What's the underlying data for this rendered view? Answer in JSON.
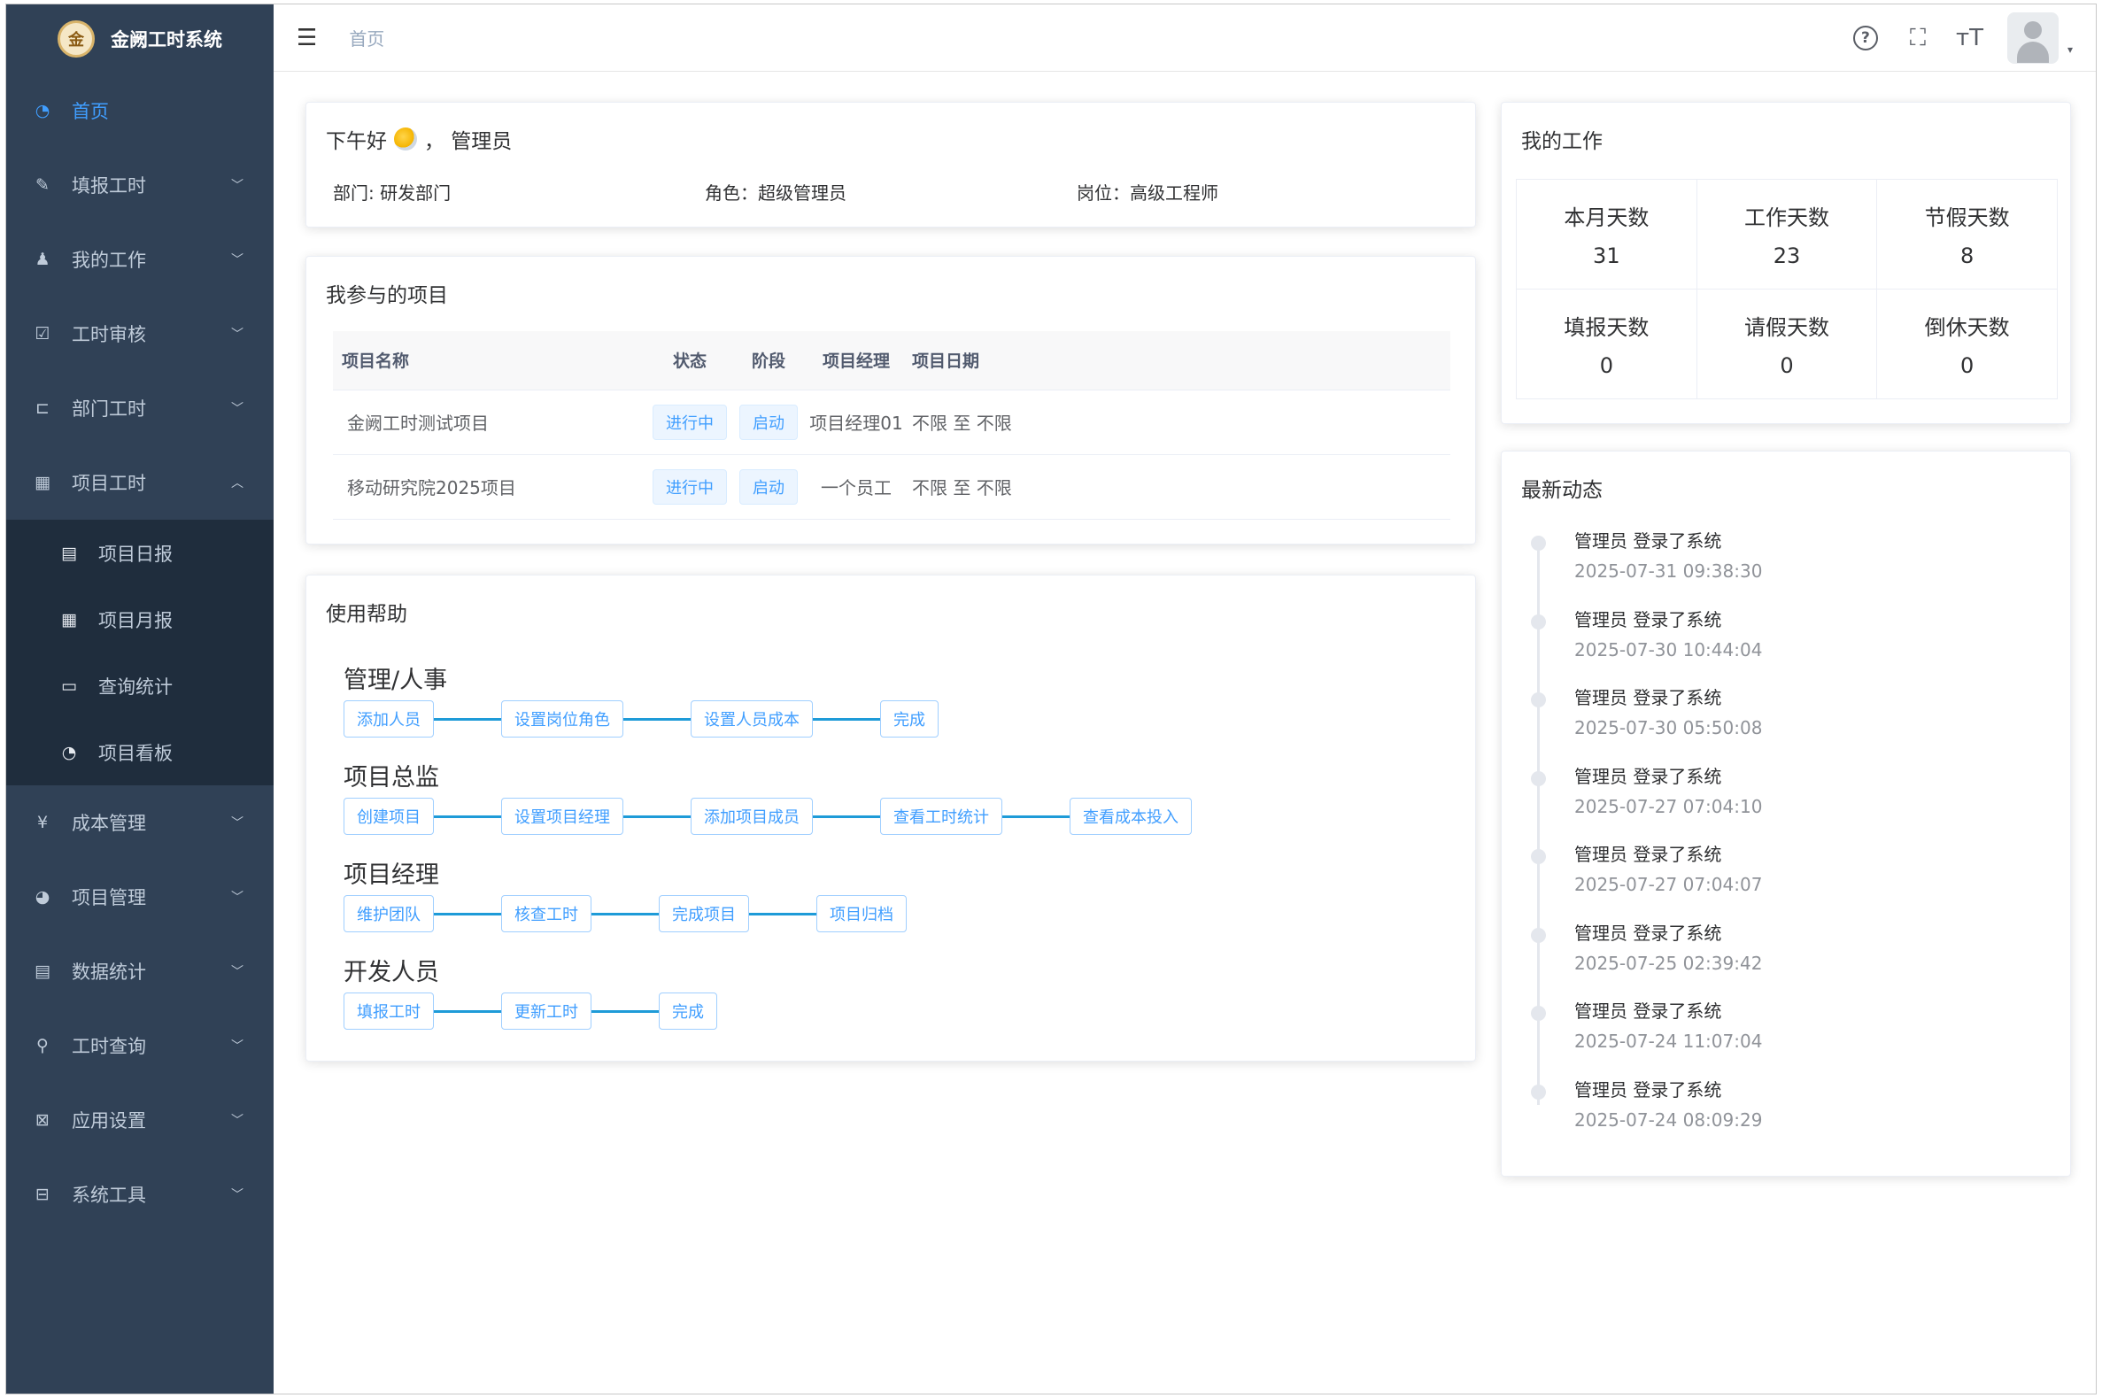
{
  "app": {
    "title": "金阙工时系统",
    "logo_glyph": "金"
  },
  "sidebar": {
    "items": [
      {
        "label": "首页",
        "icon": "dashboard-icon",
        "glyph": "◔",
        "active": true
      },
      {
        "label": "填报工时",
        "icon": "edit-icon",
        "glyph": "✎"
      },
      {
        "label": "我的工作",
        "icon": "user-icon",
        "glyph": "♟"
      },
      {
        "label": "工时审核",
        "icon": "checkbox-icon",
        "glyph": "☑"
      },
      {
        "label": "部门工时",
        "icon": "tree-icon",
        "glyph": "⊏"
      },
      {
        "label": "项目工时",
        "icon": "table-icon",
        "glyph": "▦",
        "expanded": true
      },
      {
        "label": "成本管理",
        "icon": "yen-icon",
        "glyph": "¥"
      },
      {
        "label": "项目管理",
        "icon": "globe-icon",
        "glyph": "◕"
      },
      {
        "label": "数据统计",
        "icon": "chart-icon",
        "glyph": "▤"
      },
      {
        "label": "工时查询",
        "icon": "search-icon",
        "glyph": "⚲"
      },
      {
        "label": "应用设置",
        "icon": "settings-icon",
        "glyph": "⊠"
      },
      {
        "label": "系统工具",
        "icon": "toolbox-icon",
        "glyph": "⊟"
      }
    ],
    "subitems": [
      {
        "label": "项目日报",
        "icon": "document-icon",
        "glyph": "▤"
      },
      {
        "label": "项目月报",
        "icon": "grid-icon",
        "glyph": "▦"
      },
      {
        "label": "查询统计",
        "icon": "stats-icon",
        "glyph": "▭"
      },
      {
        "label": "项目看板",
        "icon": "gauge-icon",
        "glyph": "◔"
      }
    ],
    "chevron_down": "﹀",
    "chevron_up": "︿"
  },
  "header": {
    "breadcrumb": "首页",
    "hamburger_glyph": "☰",
    "help_glyph": "?",
    "fullscreen_glyph": "⛶",
    "fontsize_glyph": "ᴛT",
    "caret_glyph": "▾"
  },
  "greeting": {
    "text_before": "下午好",
    "text_after": "， 管理员",
    "dept": "部门: 研发部门",
    "role": "角色：超级管理员",
    "post": "岗位：高级工程师"
  },
  "projects": {
    "title": "我参与的项目",
    "headers": [
      "项目名称",
      "状态",
      "阶段",
      "项目经理",
      "项目日期"
    ],
    "rows": [
      {
        "name": "金阙工时测试项目",
        "status": "进行中",
        "stage": "启动",
        "manager": "项目经理01",
        "date": "不限 至 不限"
      },
      {
        "name": "移动研究院2025项目",
        "status": "进行中",
        "stage": "启动",
        "manager": "一个员工",
        "date": "不限 至 不限"
      }
    ]
  },
  "help": {
    "title": "使用帮助",
    "flows": [
      {
        "title": "管理/人事",
        "steps": [
          "添加人员",
          "设置岗位角色",
          "设置人员成本",
          "完成"
        ]
      },
      {
        "title": "项目总监",
        "steps": [
          "创建项目",
          "设置项目经理",
          "添加项目成员",
          "查看工时统计",
          "查看成本投入"
        ]
      },
      {
        "title": "项目经理",
        "steps": [
          "维护团队",
          "核查工时",
          "完成项目",
          "项目归档"
        ]
      },
      {
        "title": "开发人员",
        "steps": [
          "填报工时",
          "更新工时",
          "完成"
        ]
      }
    ]
  },
  "work": {
    "title": "我的工作",
    "stats": [
      {
        "label": "本月天数",
        "value": "31"
      },
      {
        "label": "工作天数",
        "value": "23"
      },
      {
        "label": "节假天数",
        "value": "8"
      },
      {
        "label": "填报天数",
        "value": "0"
      },
      {
        "label": "请假天数",
        "value": "0"
      },
      {
        "label": "倒休天数",
        "value": "0"
      }
    ]
  },
  "news": {
    "title": "最新动态",
    "items": [
      {
        "text": "管理员 登录了系统",
        "time": "2025-07-31 09:38:30"
      },
      {
        "text": "管理员 登录了系统",
        "time": "2025-07-30 10:44:04"
      },
      {
        "text": "管理员 登录了系统",
        "time": "2025-07-30 05:50:08"
      },
      {
        "text": "管理员 登录了系统",
        "time": "2025-07-27 07:04:10"
      },
      {
        "text": "管理员 登录了系统",
        "time": "2025-07-27 07:04:07"
      },
      {
        "text": "管理员 登录了系统",
        "time": "2025-07-25 02:39:42"
      },
      {
        "text": "管理员 登录了系统",
        "time": "2025-07-24 11:07:04"
      },
      {
        "text": "管理员 登录了系统",
        "time": "2025-07-24 08:09:29"
      }
    ]
  },
  "colors": {
    "sidebar_bg": "#304156",
    "submenu_bg": "#1f2d3d",
    "accent": "#409eff",
    "connector": "#1e9bd8"
  }
}
